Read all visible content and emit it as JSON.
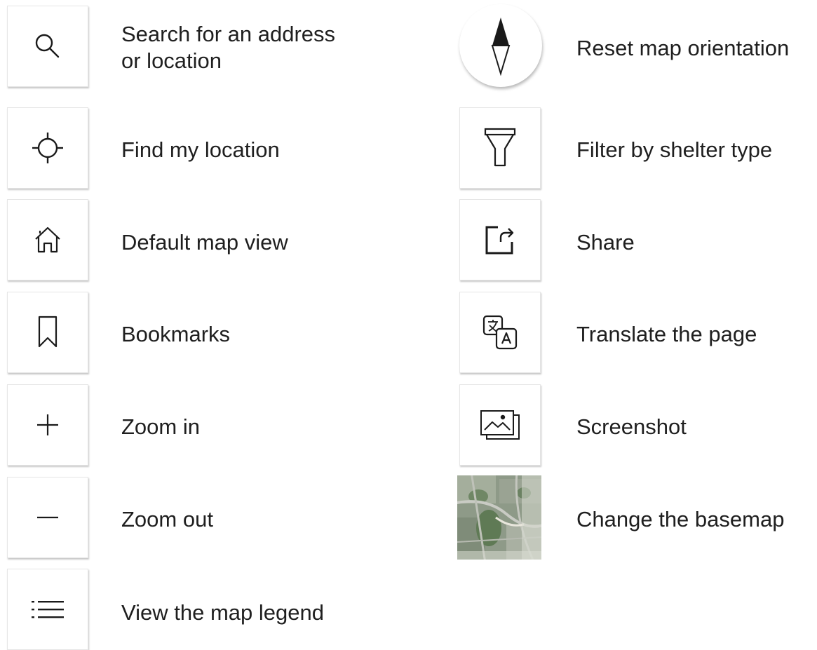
{
  "left_tools": [
    {
      "icon": "search-icon",
      "label": "Search for an address or location",
      "label_line1": "Search for an address",
      "label_line2": "or location"
    },
    {
      "icon": "locate-icon",
      "label": "Find my location"
    },
    {
      "icon": "home-icon",
      "label": "Default map view"
    },
    {
      "icon": "bookmark-icon",
      "label": "Bookmarks"
    },
    {
      "icon": "plus-icon",
      "label": "Zoom in"
    },
    {
      "icon": "minus-icon",
      "label": "Zoom out"
    },
    {
      "icon": "list-icon",
      "label": "View the map legend"
    }
  ],
  "right_tools": [
    {
      "icon": "compass-icon",
      "label": "Reset map orientation"
    },
    {
      "icon": "filter-icon",
      "label": "Filter by shelter type"
    },
    {
      "icon": "share-icon",
      "label": "Share"
    },
    {
      "icon": "translate-icon",
      "label": "Translate the page"
    },
    {
      "icon": "screenshot-icon",
      "label": "Screenshot"
    },
    {
      "icon": "basemap-thumbnail",
      "label": "Change the basemap"
    }
  ],
  "colors": {
    "icon_stroke": "#1a1a1a",
    "button_border": "#e6e6e6",
    "text": "#1f1f1f"
  }
}
